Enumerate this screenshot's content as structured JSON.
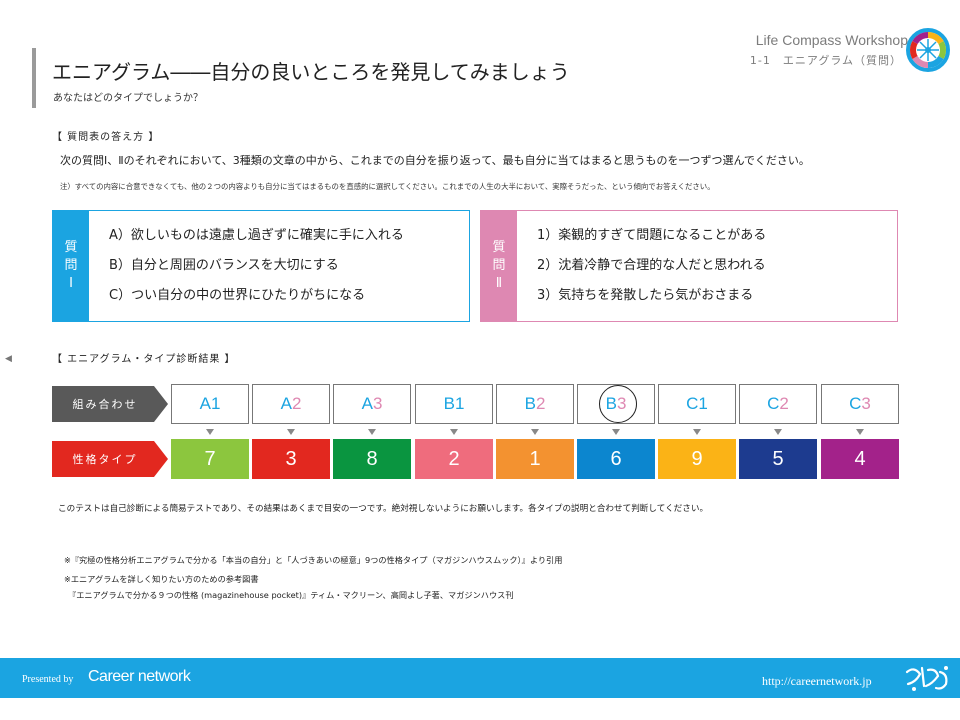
{
  "header": {
    "title": "エニアグラム――自分の良いところを発見してみましょう",
    "subtitle": "あなたはどのタイプでしょうか？",
    "brand": "Life Compass Workshop",
    "slide_ref": "1-1　エニアグラム（質問）"
  },
  "instructions": {
    "heading": "【 質問表の答え方 】",
    "text": "次の質問Ⅰ、Ⅱのそれぞれにおいて、3種類の文章の中から、これまでの自分を振り返って、最も自分に当てはまると思うものを一つずつ選んでください。",
    "note": "注）すべての内容に合意できなくても、他の２つの内容よりも自分に当てはまるものを直感的に選択してください。これまでの人生の大半において、実際そうだった、という傾向でお答えください。"
  },
  "question1": {
    "tab_chars": [
      "質",
      "問",
      "Ⅰ"
    ],
    "color": "#1ba4e1",
    "items": [
      "A）欲しいものは遠慮し過ぎずに確実に手に入れる",
      "B）自分と周囲のバランスを大切にする",
      "C）つい自分の中の世界にひたりがちになる"
    ]
  },
  "question2": {
    "tab_chars": [
      "質",
      "問",
      "Ⅱ"
    ],
    "color": "#de88b2",
    "items": [
      "1）楽観的すぎて問題になることがある",
      "2）沈着冷静で合理的な人だと思われる",
      "3）気持ちを発散したら気がおさまる"
    ]
  },
  "results": {
    "heading": "【 エニアグラム・タイプ診断結果 】",
    "combo_label": "組み合わせ",
    "type_label": "性格タイプ",
    "combo_label_color": "#595959",
    "type_label_color": "#e2281f",
    "highlighted": "B3",
    "columns": [
      {
        "letter": "A",
        "num": "1",
        "letter_color": "#1ba4e1",
        "num_color": "#1ba4e1",
        "type": "7",
        "type_color": "#8cc63e"
      },
      {
        "letter": "A",
        "num": "2",
        "letter_color": "#1ba4e1",
        "num_color": "#de88b2",
        "type": "3",
        "type_color": "#e2281f"
      },
      {
        "letter": "A",
        "num": "3",
        "letter_color": "#1ba4e1",
        "num_color": "#de88b2",
        "type": "8",
        "type_color": "#0a9540"
      },
      {
        "letter": "B",
        "num": "1",
        "letter_color": "#1ba4e1",
        "num_color": "#1ba4e1",
        "type": "2",
        "type_color": "#ef6c7d"
      },
      {
        "letter": "B",
        "num": "2",
        "letter_color": "#1ba4e1",
        "num_color": "#de88b2",
        "type": "1",
        "type_color": "#f39230"
      },
      {
        "letter": "B",
        "num": "3",
        "letter_color": "#1ba4e1",
        "num_color": "#de88b2",
        "type": "6",
        "type_color": "#0c86cf"
      },
      {
        "letter": "C",
        "num": "1",
        "letter_color": "#1ba4e1",
        "num_color": "#1ba4e1",
        "type": "9",
        "type_color": "#fbb316"
      },
      {
        "letter": "C",
        "num": "2",
        "letter_color": "#1ba4e1",
        "num_color": "#de88b2",
        "type": "5",
        "type_color": "#1d3b8f"
      },
      {
        "letter": "C",
        "num": "3",
        "letter_color": "#1ba4e1",
        "num_color": "#de88b2",
        "type": "4",
        "type_color": "#a3228a"
      }
    ]
  },
  "disclaimer": "このテストは自己診断による簡易テストであり、その結果はあくまで目安の一つです。絶対視しないようにお願いします。各タイプの説明と合わせて判断してください。",
  "references": {
    "source": "※『究極の性格分析エニアグラムで分かる「本当の自分」と「人づきあいの極意」9つの性格タイプ（マガジンハウスムック）』より引用",
    "further_heading": "※エニアグラムを詳しく知りたい方のための参考図書",
    "further_book": "『エニアグラムで分かる９つの性格 (magazinehouse pocket)』ティム・マクリーン、高岡よし子著、マガジンハウス刊"
  },
  "footer": {
    "presented_by": "Presented by",
    "brand": "Career network",
    "url": "http://careernetwork.jp",
    "accent": "#1ba4e1"
  },
  "icons": {
    "logo": "compass-wheel-logo",
    "left_nav": "triangle-left-icon",
    "row_arrow": "triangle-down-icon",
    "mascot": "mascot-logo"
  }
}
